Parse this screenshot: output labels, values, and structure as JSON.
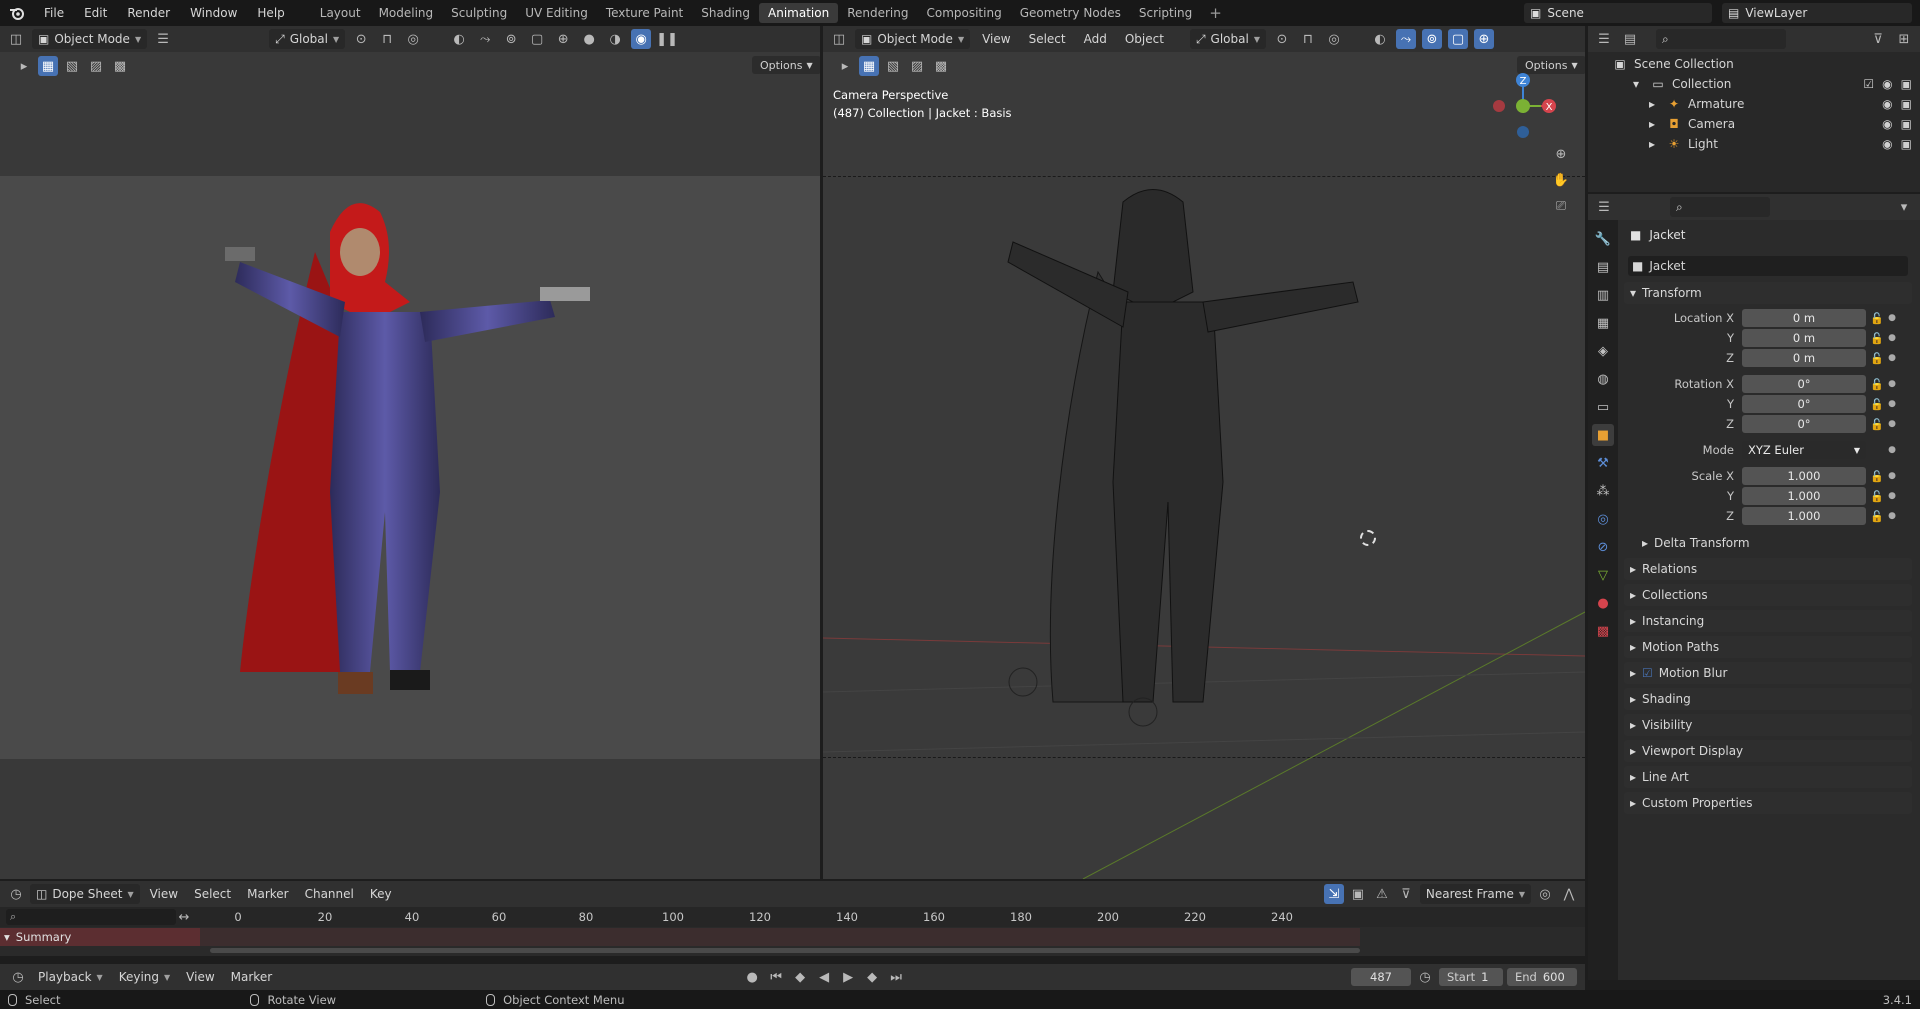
{
  "topbar": {
    "menus": [
      "File",
      "Edit",
      "Render",
      "Window",
      "Help"
    ],
    "workspace_tabs": [
      "Layout",
      "Modeling",
      "Sculpting",
      "UV Editing",
      "Texture Paint",
      "Shading",
      "Animation",
      "Rendering",
      "Compositing",
      "Geometry Nodes",
      "Scripting"
    ],
    "active_tab": "Animation",
    "scene": "Scene",
    "view_layer": "ViewLayer"
  },
  "left_viewport": {
    "mode": "Object Mode",
    "orientation": "Global",
    "options_label": "Options"
  },
  "right_viewport": {
    "mode": "Object Mode",
    "menus": [
      "View",
      "Select",
      "Add",
      "Object"
    ],
    "orientation": "Global",
    "options_label": "Options",
    "info_line1": "Camera Perspective",
    "info_line2": "(487) Collection | Jacket : Basis",
    "gizmo_axis_label": "Z",
    "gizmo_x_label": "X"
  },
  "outliner": {
    "scene_collection": "Scene Collection",
    "collection": "Collection",
    "items": [
      {
        "label": "Armature",
        "icon": "armature-icon"
      },
      {
        "label": "Camera",
        "icon": "camera-icon"
      },
      {
        "label": "Light",
        "icon": "light-icon"
      }
    ]
  },
  "properties": {
    "object_name": "Jacket",
    "name_field": "Jacket",
    "transform_label": "Transform",
    "rows": [
      {
        "label": "Location X",
        "value": "0 m"
      },
      {
        "label": "Y",
        "value": "0 m"
      },
      {
        "label": "Z",
        "value": "0 m"
      },
      {
        "label": "Rotation X",
        "value": "0°"
      },
      {
        "label": "Y",
        "value": "0°"
      },
      {
        "label": "Z",
        "value": "0°"
      },
      {
        "label": "Mode",
        "value": "XYZ Euler"
      },
      {
        "label": "Scale X",
        "value": "1.000"
      },
      {
        "label": "Y",
        "value": "1.000"
      },
      {
        "label": "Z",
        "value": "1.000"
      }
    ],
    "delta_transform": "Delta Transform",
    "panels": [
      "Relations",
      "Collections",
      "Instancing",
      "Motion Paths",
      "Motion Blur",
      "Shading",
      "Visibility",
      "Viewport Display",
      "Line Art",
      "Custom Properties"
    ]
  },
  "dopesheet": {
    "editor": "Dope Sheet",
    "menus": [
      "View",
      "Select",
      "Marker",
      "Channel",
      "Key"
    ],
    "snap": "Nearest Frame",
    "ticks": [
      "0",
      "20",
      "40",
      "60",
      "80",
      "100",
      "120",
      "140",
      "160",
      "180",
      "200",
      "220",
      "240"
    ],
    "summary": "Summary"
  },
  "timeline": {
    "menus": [
      "Playback",
      "Keying",
      "View",
      "Marker"
    ],
    "current_frame": "487",
    "start_label": "Start",
    "start_value": "1",
    "end_label": "End",
    "end_value": "600"
  },
  "statusbar": {
    "items": [
      "Select",
      "Rotate View",
      "Object Context Menu"
    ],
    "version": "3.4.1"
  },
  "colors": {
    "accent": "#4772b3",
    "active_tab_bg": "#3a3a3a",
    "summary_bg": "#5c2e31",
    "x_axis": "#d5444d",
    "y_axis": "#7bb134",
    "z_axis": "#3f84d6"
  }
}
